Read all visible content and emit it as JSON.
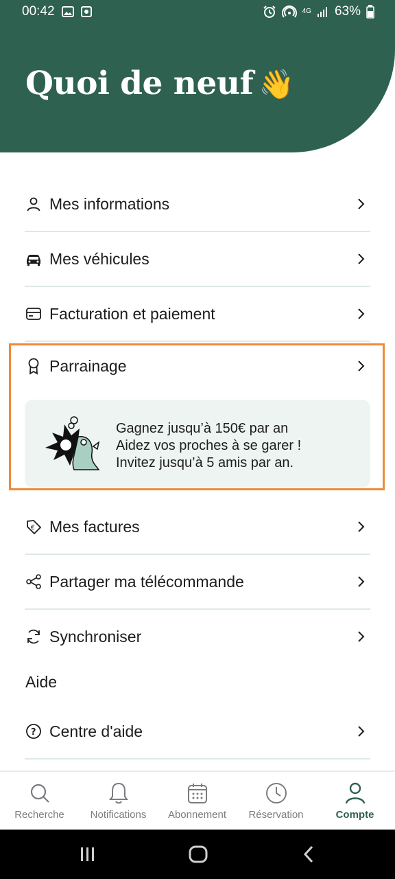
{
  "status_bar": {
    "time": "00:42",
    "battery": "63%",
    "network": "4G"
  },
  "header": {
    "title": "Quoi de neuf",
    "emoji": "👋"
  },
  "menu": [
    {
      "label": "Mes informations",
      "icon": "person-icon"
    },
    {
      "label": "Mes véhicules",
      "icon": "car-icon"
    },
    {
      "label": "Facturation et paiement",
      "icon": "card-icon"
    }
  ],
  "referral": {
    "label": "Parrainage",
    "icon": "award-icon",
    "promo_line1": "Gagnez jusqu’à 150€ par an",
    "promo_line2": "Aidez vos proches à se garer !",
    "promo_line3": "Invitez jusqu’à 5 amis par an."
  },
  "menu2": [
    {
      "label": "Mes factures",
      "icon": "tag-euro-icon"
    },
    {
      "label": "Partager ma télécommande",
      "icon": "share-icon"
    },
    {
      "label": "Synchroniser",
      "icon": "sync-icon"
    }
  ],
  "aide": {
    "title": "Aide",
    "items": [
      {
        "label": "Centre d'aide",
        "icon": "help-icon"
      }
    ]
  },
  "bottom_nav": [
    {
      "label": "Recherche",
      "icon": "search-icon"
    },
    {
      "label": "Notifications",
      "icon": "bell-icon"
    },
    {
      "label": "Abonnement",
      "icon": "calendar-icon"
    },
    {
      "label": "Réservation",
      "icon": "clock-icon"
    },
    {
      "label": "Compte",
      "icon": "user-icon",
      "active": true
    }
  ],
  "colors": {
    "brand": "#2f6150",
    "highlight": "#ee8a3a",
    "divider": "#dde9e5",
    "card": "#eef4f2"
  }
}
